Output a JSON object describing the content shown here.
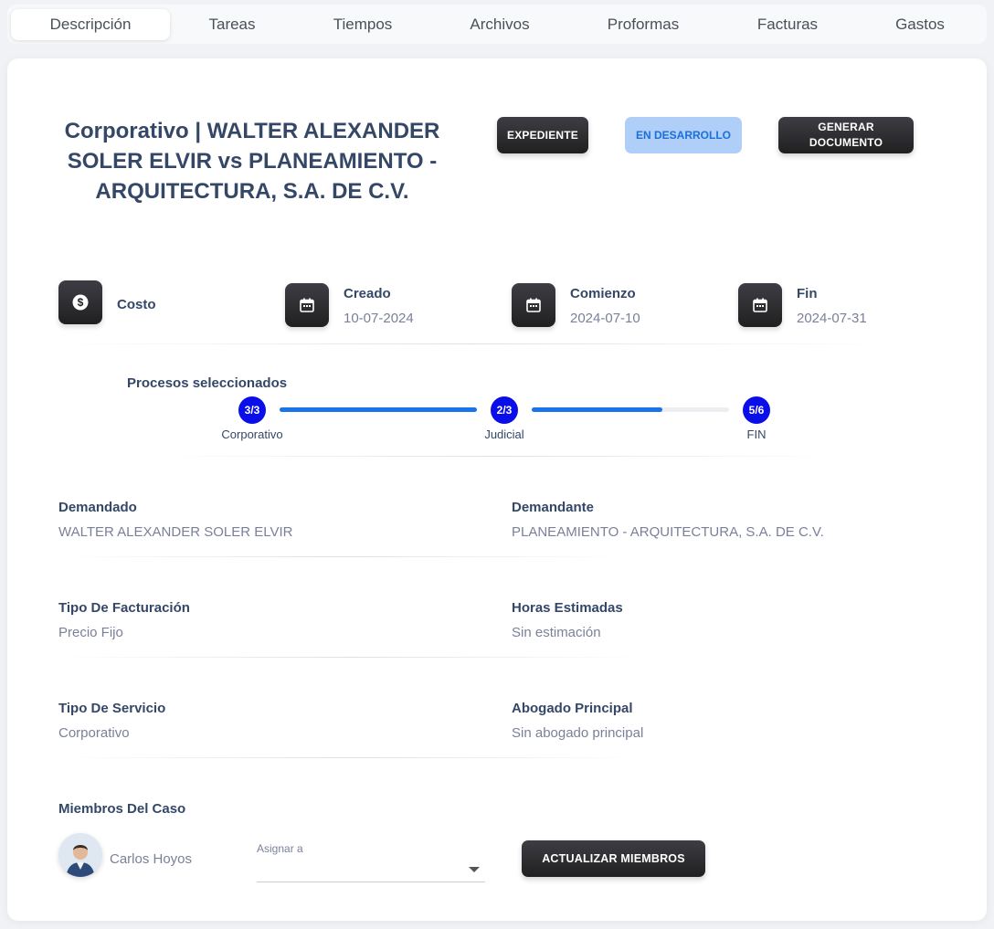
{
  "tabs": [
    {
      "label": "Descripción",
      "active": true
    },
    {
      "label": "Tareas"
    },
    {
      "label": "Tiempos"
    },
    {
      "label": "Archivos"
    },
    {
      "label": "Proformas"
    },
    {
      "label": "Facturas"
    },
    {
      "label": "Gastos"
    }
  ],
  "case": {
    "title": "Corporativo | WALTER ALEXANDER SOLER ELVIR vs PLANEAMIENTO - ARQUITECTURA, S.A. DE C.V.",
    "expediente_label": "EXPEDIENTE",
    "status_label": "EN DESARROLLO",
    "generate_label": "GENERAR DOCUMENTO"
  },
  "info": {
    "cost": {
      "label": "Costo",
      "value": "",
      "icon": "dollar-icon"
    },
    "created": {
      "label": "Creado",
      "value": "10-07-2024",
      "icon": "calendar-icon"
    },
    "start": {
      "label": "Comienzo",
      "value": "2024-07-10",
      "icon": "calendar-icon"
    },
    "end": {
      "label": "Fin",
      "value": "2024-07-31",
      "icon": "calendar-icon"
    }
  },
  "processes": {
    "heading": "Procesos seleccionados",
    "steps": [
      {
        "badge": "3/3",
        "label": "Corporativo"
      },
      {
        "badge": "2/3",
        "label": "Judicial"
      },
      {
        "badge": "5/6",
        "label": "FIN"
      }
    ],
    "progress": [
      1.0,
      0.66
    ]
  },
  "details": {
    "demandado": {
      "label": "Demandado",
      "value": "WALTER ALEXANDER SOLER ELVIR"
    },
    "demandante": {
      "label": "Demandante",
      "value": "PLANEAMIENTO - ARQUITECTURA, S.A. DE C.V."
    },
    "facturacion": {
      "label": "Tipo De Facturación",
      "value": "Precio Fijo"
    },
    "horas": {
      "label": "Horas Estimadas",
      "value": "Sin estimación"
    },
    "servicio": {
      "label": "Tipo De Servicio",
      "value": "Corporativo"
    },
    "abogado": {
      "label": "Abogado Principal",
      "value": "Sin abogado principal"
    }
  },
  "members": {
    "heading": "Miembros Del Caso",
    "list": [
      {
        "name": "Carlos Hoyos"
      }
    ],
    "assign_label": "Asignar a",
    "assign_value": "",
    "update_label": "ACTUALIZAR MIEMBROS"
  },
  "colors": {
    "accent": "#1a73e8",
    "step": "#0a0ee8",
    "status_bg": "#b0cff8",
    "status_text": "#1a6fd8",
    "dark": "#202020"
  }
}
